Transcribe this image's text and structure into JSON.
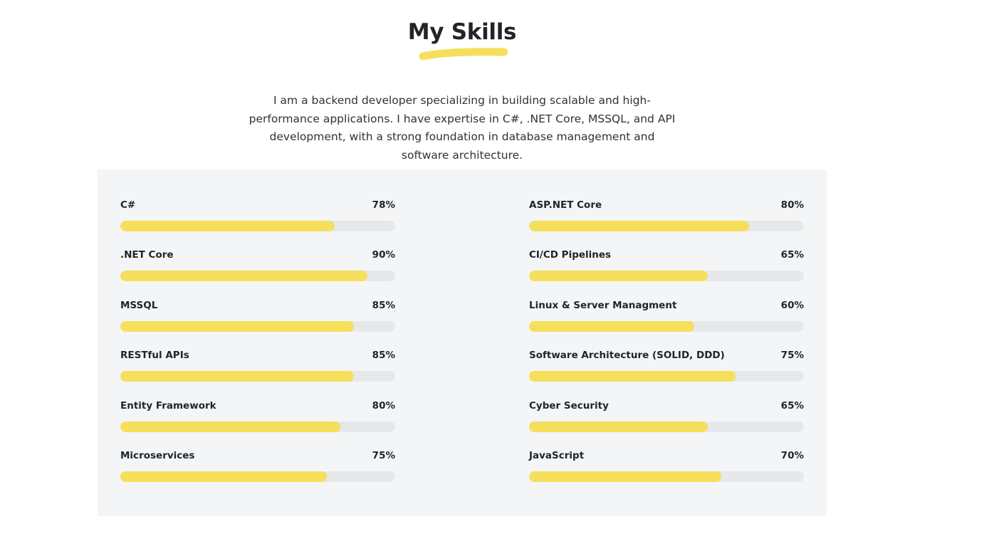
{
  "section": {
    "title": "My Skills",
    "accent_color": "#f6df5c",
    "intro": "I am a backend developer specializing in building scalable and high-performance applications. I have expertise in C#, .NET Core, MSSQL, and API development, with a strong foundation in database management and software architecture."
  },
  "skills": {
    "left": [
      {
        "name": "C#",
        "percent_label": "78%",
        "level": 78
      },
      {
        "name": ".NET Core",
        "percent_label": "90%",
        "level": 90
      },
      {
        "name": "MSSQL",
        "percent_label": "85%",
        "level": 85
      },
      {
        "name": "RESTful APIs",
        "percent_label": "85%",
        "level": 85
      },
      {
        "name": "Entity Framework",
        "percent_label": "80%",
        "level": 80
      },
      {
        "name": "Microservices",
        "percent_label": "75%",
        "level": 75
      }
    ],
    "right": [
      {
        "name": "ASP.NET Core",
        "percent_label": "80%",
        "level": 80
      },
      {
        "name": "CI/CD Pipelines",
        "percent_label": "65%",
        "level": 65
      },
      {
        "name": "Linux & Server Managment",
        "percent_label": "60%",
        "level": 60
      },
      {
        "name": "Software Architecture (SOLID, DDD)",
        "percent_label": "75%",
        "level": 75
      },
      {
        "name": "Cyber Security",
        "percent_label": "65%",
        "level": 65
      },
      {
        "name": "JavaScript",
        "percent_label": "70%",
        "level": 70
      }
    ]
  }
}
